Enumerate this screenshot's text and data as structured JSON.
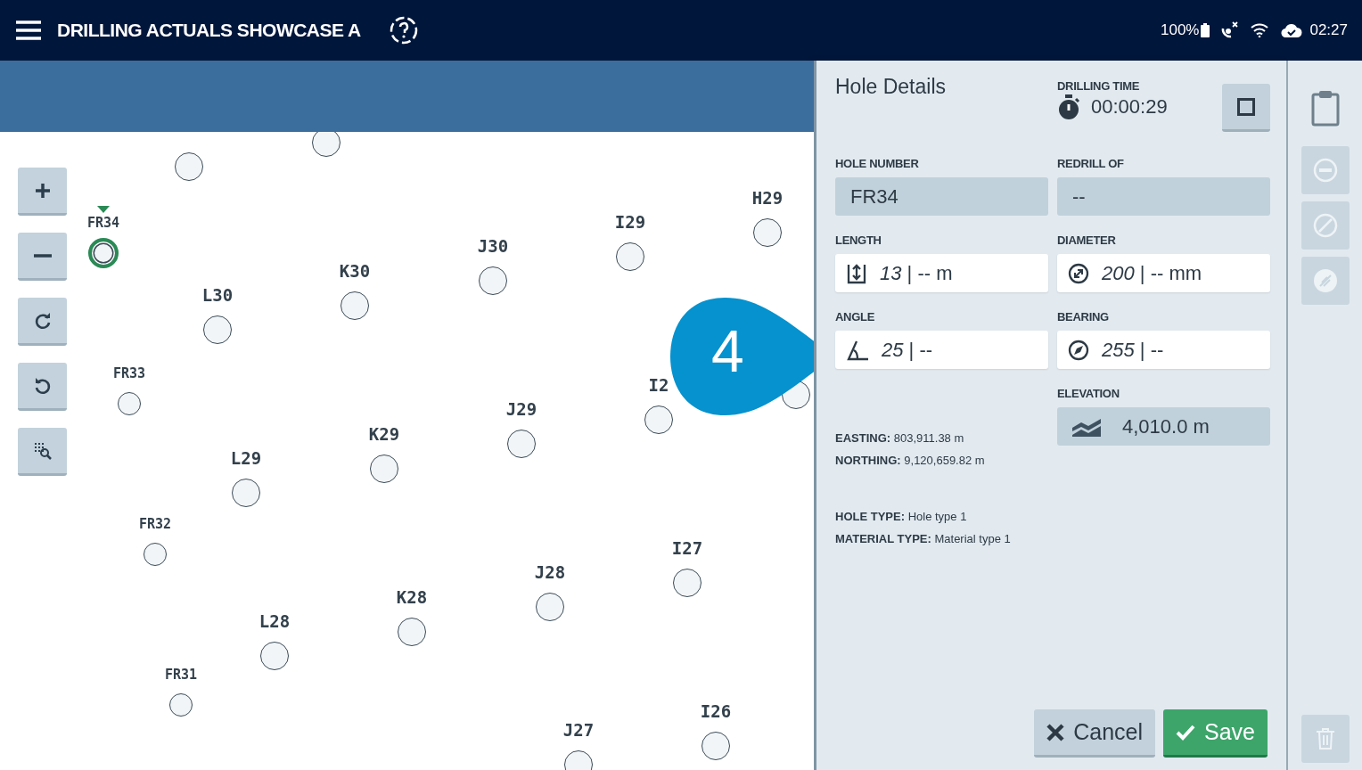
{
  "header": {
    "title": "DRILLING ACTUALS SHOWCASE A",
    "battery": "100%",
    "time": "02:27"
  },
  "map_tools": [
    {
      "kind": "zoom_in"
    },
    {
      "kind": "zoom_out"
    },
    {
      "kind": "redo"
    },
    {
      "kind": "undo"
    },
    {
      "kind": "select"
    }
  ],
  "holes": [
    {
      "small": false,
      "selected": false
    },
    {
      "small": false,
      "selected": false
    },
    {
      "label": "FR34",
      "small": true,
      "selected": true
    },
    {
      "label": "H29",
      "small": false,
      "selected": false
    },
    {
      "label": "I29",
      "small": false,
      "selected": false
    },
    {
      "label": "J30",
      "small": false,
      "selected": false
    },
    {
      "label": "K30",
      "small": false,
      "selected": false
    },
    {
      "label": "L30",
      "small": false,
      "selected": false
    },
    {
      "label": "FR33",
      "small": true,
      "selected": false
    },
    {
      "small": false,
      "selected": false
    },
    {
      "label": "I2",
      "small": false,
      "selected": false
    },
    {
      "label": "J29",
      "small": false,
      "selected": false
    },
    {
      "label": "K29",
      "small": false,
      "selected": false
    },
    {
      "label": "L29",
      "small": false,
      "selected": false
    },
    {
      "label": "FR32",
      "small": true,
      "selected": false
    },
    {
      "label": "I27",
      "small": false,
      "selected": false
    },
    {
      "label": "J28",
      "small": false,
      "selected": false
    },
    {
      "label": "K28",
      "small": false,
      "selected": false
    },
    {
      "label": "L28",
      "small": false,
      "selected": false
    },
    {
      "label": "FR31",
      "small": true,
      "selected": false
    },
    {
      "label": "I26",
      "small": false,
      "selected": false
    },
    {
      "label": "J27",
      "small": false,
      "selected": false
    }
  ],
  "callout": "4",
  "panel": {
    "title": "Hole Details",
    "drilling_time": {
      "label": "DRILLING TIME",
      "value": "00:00:29"
    },
    "fields": [
      {
        "label": "HOLE NUMBER",
        "value": "FR34",
        "kind": "readonly"
      },
      {
        "label": "REDRILL OF",
        "value": "--",
        "kind": "readonly"
      },
      {
        "label": "LENGTH",
        "value": "*13* | -- m",
        "kind": "input"
      },
      {
        "label": "DIAMETER",
        "value": "*200* | -- mm",
        "kind": "input"
      },
      {
        "label": "ANGLE",
        "value": "*25* | --",
        "kind": "input"
      },
      {
        "label": "BEARING",
        "value": "*255* | --",
        "kind": "input"
      }
    ],
    "coordinates": [
      "**EASTING:** 803,911.38 m",
      "**NORTHING:** 9,120,659.82 m"
    ],
    "elevation": {
      "label": "ELEVATION",
      "value": "4,010.0 m"
    },
    "types": [
      "**HOLE TYPE:** Hole type 1",
      "**MATERIAL TYPE:** Material type 1"
    ],
    "buttons": [
      {
        "label": "Cancel",
        "kind": "secondary"
      },
      {
        "label": "Save",
        "kind": "primary"
      }
    ]
  },
  "side_tools": [
    {
      "kind": "clipboard",
      "disabled": false
    },
    {
      "kind": "minus",
      "disabled": true
    },
    {
      "kind": "block",
      "disabled": true
    },
    {
      "kind": "strike",
      "disabled": true
    },
    {
      "kind": "trash",
      "disabled": true
    }
  ]
}
